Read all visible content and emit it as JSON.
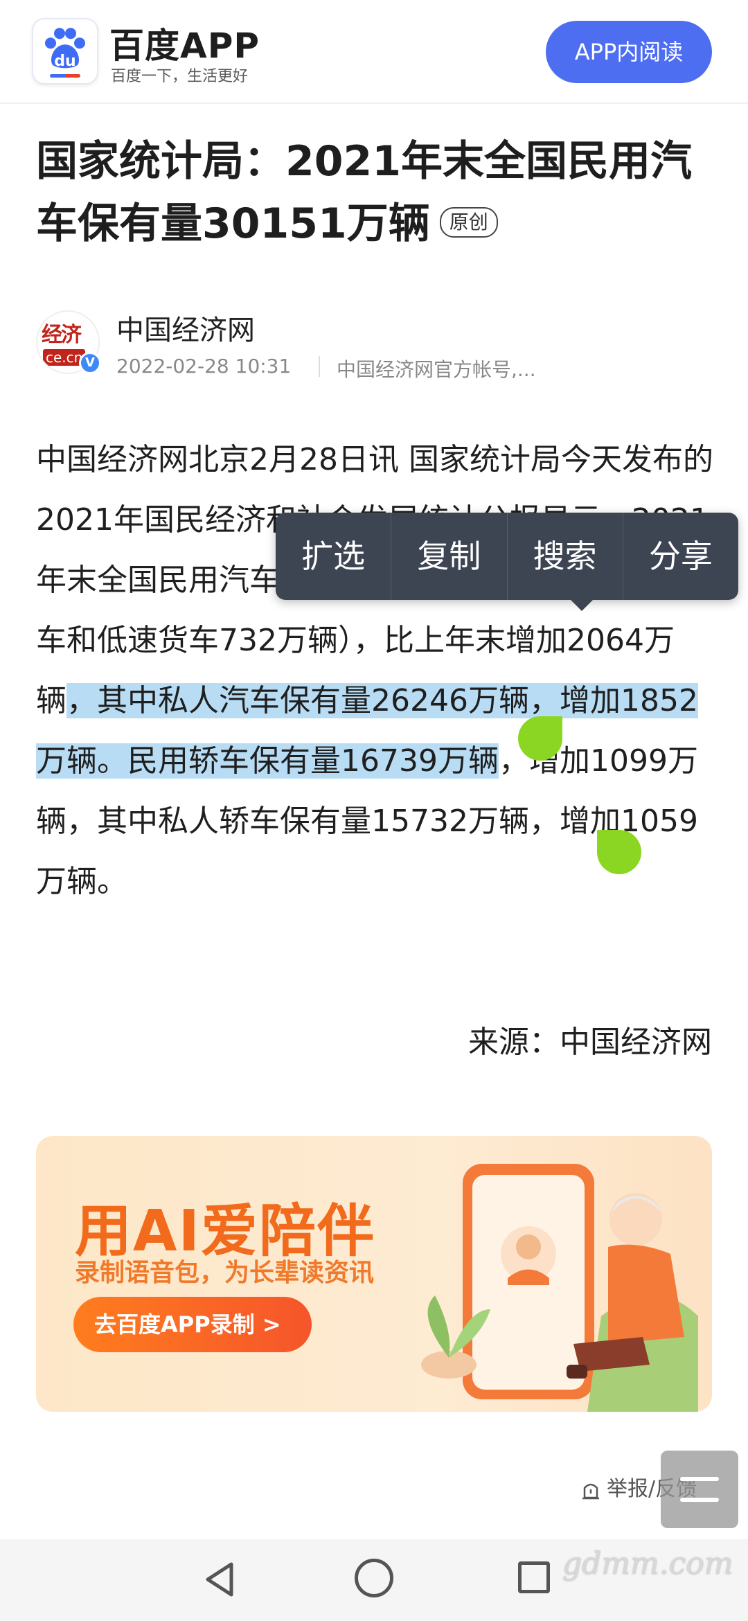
{
  "header": {
    "app_name": "百度APP",
    "slogan": "百度一下，生活更好",
    "open_in_app_label": "APP内阅读",
    "logo_text": "du"
  },
  "article": {
    "title": "国家统计局：2021年末全国民用汽车保有量30151万辆",
    "original_tag": "原创",
    "author": {
      "name": "中国经济网",
      "avatar_seal": "经济",
      "avatar_domain": "ce.cn",
      "verified_mark": "V",
      "time": "2022-02-28 10:31",
      "description": "中国经济网官方帐号,..."
    },
    "body_before_selection": "中国经济网北京2月28日讯 国家统计局今天发布的2021年国民经济和社会发展统计公报显示，2021年末全国民用汽车保有量30151万辆（包括三轮汽车和低速货车732万辆），比上年末增加2064万辆",
    "body_selected": "，其中私人汽车保有量26246万辆，增加1852万辆。民用轿车保有量16739万辆",
    "body_after_selection": "，增加1099万辆，其中私人轿车保有量15732万辆，增加1059万辆。",
    "source": "来源：中国经济网"
  },
  "context_menu": {
    "items": [
      "扩选",
      "复制",
      "搜索",
      "分享"
    ]
  },
  "banner": {
    "title": "用AI爱陪伴",
    "subtitle": "录制语音包，为长辈读资讯",
    "button_label": "去百度APP录制 >"
  },
  "footer": {
    "report_label": "举报/反馈"
  },
  "watermark": "gdmm.com",
  "colors": {
    "accent": "#4e6ef2",
    "selection": "#b8dcf3",
    "handle": "#8ad622",
    "menu_bg": "#3d4452",
    "banner_orange": "#f26a1b"
  }
}
